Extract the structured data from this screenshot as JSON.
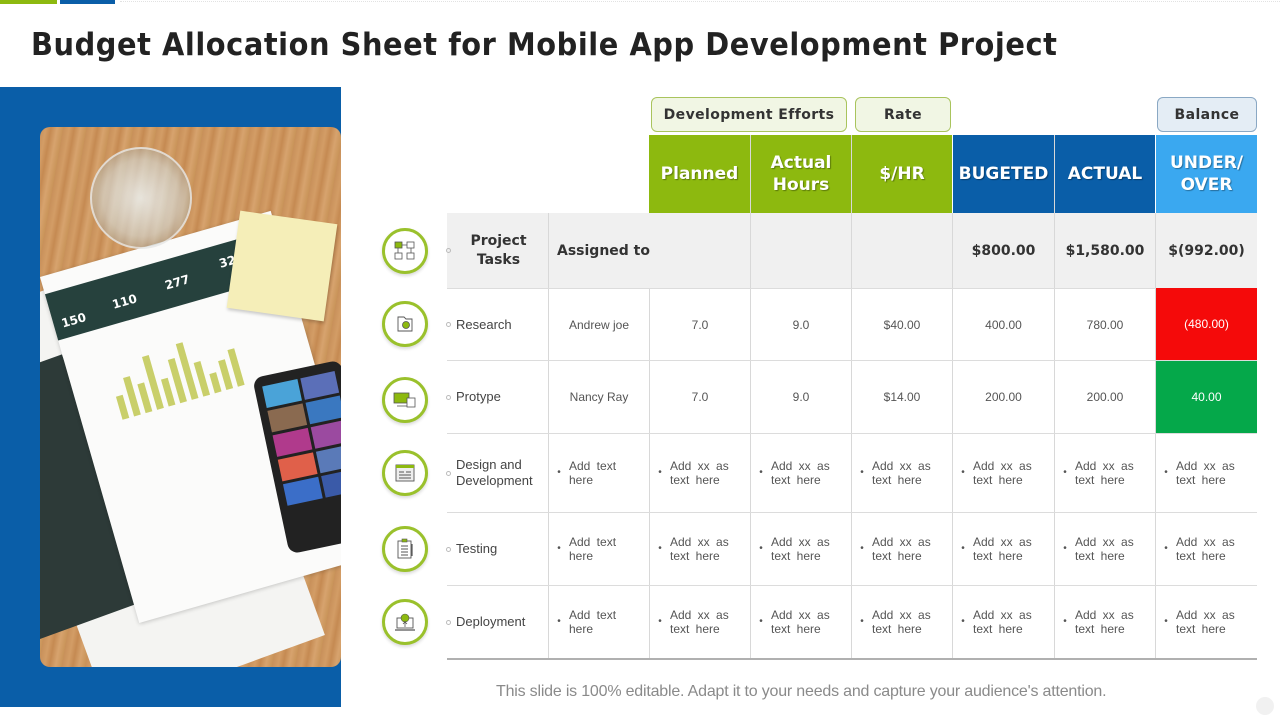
{
  "slide": {
    "title": "Budget Allocation Sheet for Mobile App Development Project",
    "footer": "This slide is 100% editable. Adapt it to your needs and capture your audience's attention."
  },
  "colors": {
    "accent_green": "#8db90f",
    "accent_blue": "#0a5ea8",
    "light_blue": "#3aa8f0",
    "over_budget_red": "#f50a0a",
    "under_budget_green": "#05a84a"
  },
  "photo": {
    "description": "Desk with glass, sticky note, printed analytics report and smartphone",
    "report_metrics": [
      "150",
      "110",
      "277",
      "32"
    ]
  },
  "group_headers": {
    "development_efforts": "Development Efforts",
    "rate": "Rate",
    "balance": "Balance"
  },
  "columns": {
    "planned": "Planned",
    "actual_hours_1": "Actual",
    "actual_hours_2": "Hours",
    "rate": "$/HR",
    "budgeted": "BUGETED",
    "actual": "ACTUAL",
    "under_over_1": "UNDER/",
    "under_over_2": "OVER"
  },
  "summary": {
    "tasks_label_1": "Project",
    "tasks_label_2": "Tasks",
    "assigned_label": "Assigned to",
    "budgeted_total": "$800.00",
    "actual_total": "$1,580.00",
    "balance_total": "$(992.00)"
  },
  "rows": [
    {
      "task": "Research",
      "icon": "folder-gear-icon",
      "assigned": "Andrew joe",
      "planned": "7.0",
      "actual_hours": "9.0",
      "rate": "$40.00",
      "budgeted": "400.00",
      "actual": "780.00",
      "balance": "(480.00)",
      "balance_status": "over"
    },
    {
      "task": "Protype",
      "icon": "devices-icon",
      "assigned": "Nancy Ray",
      "planned": "7.0",
      "actual_hours": "9.0",
      "rate": "$14.00",
      "budgeted": "200.00",
      "actual": "200.00",
      "balance": "40.00",
      "balance_status": "under"
    },
    {
      "task_1": "Design and",
      "task_2": "Development",
      "icon": "web-design-icon",
      "assigned_1": "Add text",
      "assigned_2": "here",
      "placeholder_1": "Add  xx as",
      "placeholder_2": "text here"
    },
    {
      "task": "Testing",
      "icon": "clipboard-checklist-icon",
      "assigned_1": "Add text",
      "assigned_2": "here",
      "placeholder_1": "Add  xx as",
      "placeholder_2": "text here"
    },
    {
      "task": "Deployment",
      "icon": "laptop-upload-icon",
      "assigned_1": "Add text",
      "assigned_2": "here",
      "placeholder_1": "Add  xx as",
      "placeholder_2": "text here"
    }
  ],
  "bullet": "•"
}
